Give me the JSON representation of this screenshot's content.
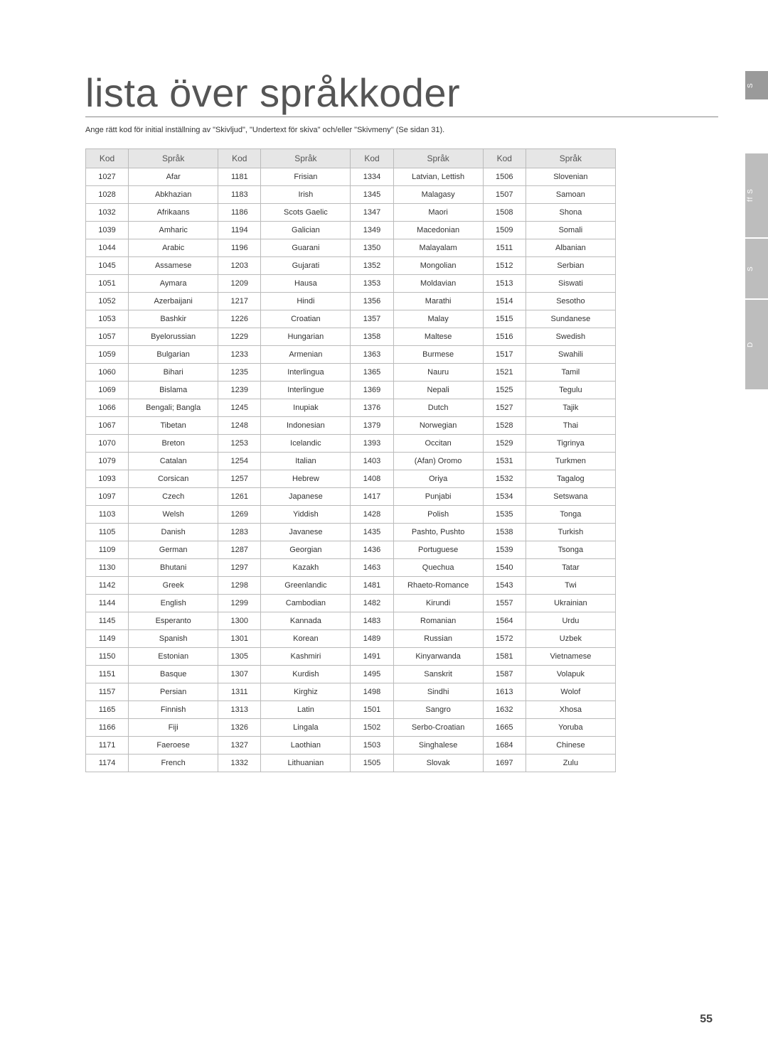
{
  "title": "lista över språkkoder",
  "intro": "Ange rätt kod för initial inställning av \"Skivljud\", \"Undertext för skiva\" och/eller \"Skivmeny\" (Se sidan 31).",
  "headers": {
    "code": "Kod",
    "lang": "Språk"
  },
  "side_tabs": [
    "S",
    "ff   S",
    "S",
    "D"
  ],
  "page_number": "55",
  "rows": [
    [
      [
        "1027",
        "Afar"
      ],
      [
        "1181",
        "Frisian"
      ],
      [
        "1334",
        "Latvian, Lettish"
      ],
      [
        "1506",
        "Slovenian"
      ]
    ],
    [
      [
        "1028",
        "Abkhazian"
      ],
      [
        "1183",
        "Irish"
      ],
      [
        "1345",
        "Malagasy"
      ],
      [
        "1507",
        "Samoan"
      ]
    ],
    [
      [
        "1032",
        "Afrikaans"
      ],
      [
        "1186",
        "Scots Gaelic"
      ],
      [
        "1347",
        "Maori"
      ],
      [
        "1508",
        "Shona"
      ]
    ],
    [
      [
        "1039",
        "Amharic"
      ],
      [
        "1194",
        "Galician"
      ],
      [
        "1349",
        "Macedonian"
      ],
      [
        "1509",
        "Somali"
      ]
    ],
    [
      [
        "1044",
        "Arabic"
      ],
      [
        "1196",
        "Guarani"
      ],
      [
        "1350",
        "Malayalam"
      ],
      [
        "1511",
        "Albanian"
      ]
    ],
    [
      [
        "1045",
        "Assamese"
      ],
      [
        "1203",
        "Gujarati"
      ],
      [
        "1352",
        "Mongolian"
      ],
      [
        "1512",
        "Serbian"
      ]
    ],
    [
      [
        "1051",
        "Aymara"
      ],
      [
        "1209",
        "Hausa"
      ],
      [
        "1353",
        "Moldavian"
      ],
      [
        "1513",
        "Siswati"
      ]
    ],
    [
      [
        "1052",
        "Azerbaijani"
      ],
      [
        "1217",
        "Hindi"
      ],
      [
        "1356",
        "Marathi"
      ],
      [
        "1514",
        "Sesotho"
      ]
    ],
    [
      [
        "1053",
        "Bashkir"
      ],
      [
        "1226",
        "Croatian"
      ],
      [
        "1357",
        "Malay"
      ],
      [
        "1515",
        "Sundanese"
      ]
    ],
    [
      [
        "1057",
        "Byelorussian"
      ],
      [
        "1229",
        "Hungarian"
      ],
      [
        "1358",
        "Maltese"
      ],
      [
        "1516",
        "Swedish"
      ]
    ],
    [
      [
        "1059",
        "Bulgarian"
      ],
      [
        "1233",
        "Armenian"
      ],
      [
        "1363",
        "Burmese"
      ],
      [
        "1517",
        "Swahili"
      ]
    ],
    [
      [
        "1060",
        "Bihari"
      ],
      [
        "1235",
        "Interlingua"
      ],
      [
        "1365",
        "Nauru"
      ],
      [
        "1521",
        "Tamil"
      ]
    ],
    [
      [
        "1069",
        "Bislama"
      ],
      [
        "1239",
        "Interlingue"
      ],
      [
        "1369",
        "Nepali"
      ],
      [
        "1525",
        "Tegulu"
      ]
    ],
    [
      [
        "1066",
        "Bengali; Bangla"
      ],
      [
        "1245",
        "Inupiak"
      ],
      [
        "1376",
        "Dutch"
      ],
      [
        "1527",
        "Tajik"
      ]
    ],
    [
      [
        "1067",
        "Tibetan"
      ],
      [
        "1248",
        "Indonesian"
      ],
      [
        "1379",
        "Norwegian"
      ],
      [
        "1528",
        "Thai"
      ]
    ],
    [
      [
        "1070",
        "Breton"
      ],
      [
        "1253",
        "Icelandic"
      ],
      [
        "1393",
        "Occitan"
      ],
      [
        "1529",
        "Tigrinya"
      ]
    ],
    [
      [
        "1079",
        "Catalan"
      ],
      [
        "1254",
        "Italian"
      ],
      [
        "1403",
        "(Afan) Oromo"
      ],
      [
        "1531",
        "Turkmen"
      ]
    ],
    [
      [
        "1093",
        "Corsican"
      ],
      [
        "1257",
        "Hebrew"
      ],
      [
        "1408",
        "Oriya"
      ],
      [
        "1532",
        "Tagalog"
      ]
    ],
    [
      [
        "1097",
        "Czech"
      ],
      [
        "1261",
        "Japanese"
      ],
      [
        "1417",
        "Punjabi"
      ],
      [
        "1534",
        "Setswana"
      ]
    ],
    [
      [
        "1103",
        "Welsh"
      ],
      [
        "1269",
        "Yiddish"
      ],
      [
        "1428",
        "Polish"
      ],
      [
        "1535",
        "Tonga"
      ]
    ],
    [
      [
        "1105",
        "Danish"
      ],
      [
        "1283",
        "Javanese"
      ],
      [
        "1435",
        "Pashto, Pushto"
      ],
      [
        "1538",
        "Turkish"
      ]
    ],
    [
      [
        "1109",
        "German"
      ],
      [
        "1287",
        "Georgian"
      ],
      [
        "1436",
        "Portuguese"
      ],
      [
        "1539",
        "Tsonga"
      ]
    ],
    [
      [
        "1130",
        "Bhutani"
      ],
      [
        "1297",
        "Kazakh"
      ],
      [
        "1463",
        "Quechua"
      ],
      [
        "1540",
        "Tatar"
      ]
    ],
    [
      [
        "1142",
        "Greek"
      ],
      [
        "1298",
        "Greenlandic"
      ],
      [
        "1481",
        "Rhaeto-Romance"
      ],
      [
        "1543",
        "Twi"
      ]
    ],
    [
      [
        "1144",
        "English"
      ],
      [
        "1299",
        "Cambodian"
      ],
      [
        "1482",
        "Kirundi"
      ],
      [
        "1557",
        "Ukrainian"
      ]
    ],
    [
      [
        "1145",
        "Esperanto"
      ],
      [
        "1300",
        "Kannada"
      ],
      [
        "1483",
        "Romanian"
      ],
      [
        "1564",
        "Urdu"
      ]
    ],
    [
      [
        "1149",
        "Spanish"
      ],
      [
        "1301",
        "Korean"
      ],
      [
        "1489",
        "Russian"
      ],
      [
        "1572",
        "Uzbek"
      ]
    ],
    [
      [
        "1150",
        "Estonian"
      ],
      [
        "1305",
        "Kashmiri"
      ],
      [
        "1491",
        "Kinyarwanda"
      ],
      [
        "1581",
        "Vietnamese"
      ]
    ],
    [
      [
        "1151",
        "Basque"
      ],
      [
        "1307",
        "Kurdish"
      ],
      [
        "1495",
        "Sanskrit"
      ],
      [
        "1587",
        "Volapuk"
      ]
    ],
    [
      [
        "1157",
        "Persian"
      ],
      [
        "1311",
        "Kirghiz"
      ],
      [
        "1498",
        "Sindhi"
      ],
      [
        "1613",
        "Wolof"
      ]
    ],
    [
      [
        "1165",
        "Finnish"
      ],
      [
        "1313",
        "Latin"
      ],
      [
        "1501",
        "Sangro"
      ],
      [
        "1632",
        "Xhosa"
      ]
    ],
    [
      [
        "1166",
        "Fiji"
      ],
      [
        "1326",
        "Lingala"
      ],
      [
        "1502",
        "Serbo-Croatian"
      ],
      [
        "1665",
        "Yoruba"
      ]
    ],
    [
      [
        "1171",
        "Faeroese"
      ],
      [
        "1327",
        "Laothian"
      ],
      [
        "1503",
        "Singhalese"
      ],
      [
        "1684",
        "Chinese"
      ]
    ],
    [
      [
        "1174",
        "French"
      ],
      [
        "1332",
        "Lithuanian"
      ],
      [
        "1505",
        "Slovak"
      ],
      [
        "1697",
        "Zulu"
      ]
    ]
  ]
}
